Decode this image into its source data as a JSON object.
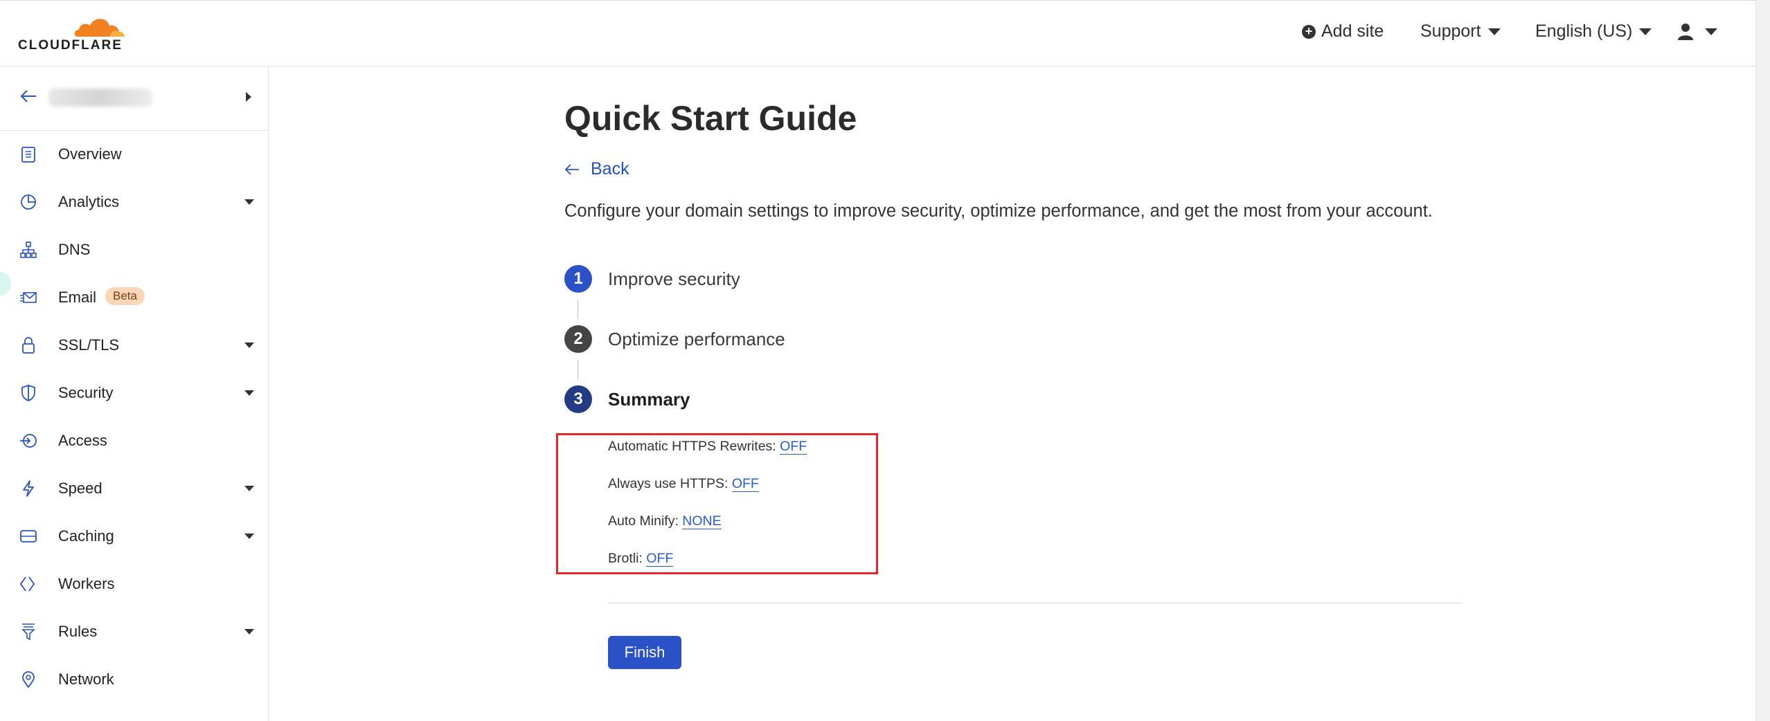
{
  "header": {
    "logo_text": "CLOUDFLARE",
    "add_site": "Add site",
    "support": "Support",
    "language": "English (US)"
  },
  "sidebar": {
    "items": [
      {
        "label": "Overview",
        "icon": "clipboard-icon",
        "expandable": false
      },
      {
        "label": "Analytics",
        "icon": "pie-chart-icon",
        "expandable": true
      },
      {
        "label": "DNS",
        "icon": "network-tree-icon",
        "expandable": false
      },
      {
        "label": "Email",
        "icon": "envelope-icon",
        "expandable": false,
        "badge": "Beta"
      },
      {
        "label": "SSL/TLS",
        "icon": "lock-icon",
        "expandable": true
      },
      {
        "label": "Security",
        "icon": "shield-icon",
        "expandable": true
      },
      {
        "label": "Access",
        "icon": "access-icon",
        "expandable": false
      },
      {
        "label": "Speed",
        "icon": "lightning-icon",
        "expandable": true
      },
      {
        "label": "Caching",
        "icon": "storage-icon",
        "expandable": true
      },
      {
        "label": "Workers",
        "icon": "workers-icon",
        "expandable": false
      },
      {
        "label": "Rules",
        "icon": "filter-icon",
        "expandable": true
      },
      {
        "label": "Network",
        "icon": "location-pin-icon",
        "expandable": false
      }
    ]
  },
  "main": {
    "title": "Quick Start Guide",
    "back": "Back",
    "intro": "Configure your domain settings to improve security, optimize performance, and get the most from your account.",
    "steps": [
      {
        "number": "1",
        "label": "Improve security"
      },
      {
        "number": "2",
        "label": "Optimize performance"
      },
      {
        "number": "3",
        "label": "Summary"
      }
    ],
    "summary": [
      {
        "label": "Automatic HTTPS Rewrites:",
        "value": "OFF"
      },
      {
        "label": "Always use HTTPS:",
        "value": "OFF"
      },
      {
        "label": "Auto Minify:",
        "value": "NONE"
      },
      {
        "label": "Brotli:",
        "value": "OFF"
      }
    ],
    "finish": "Finish"
  },
  "colors": {
    "accent": "#2a51c6",
    "link": "#2a5bd7",
    "brand_orange": "#f38020",
    "highlight": "#e3262f"
  }
}
